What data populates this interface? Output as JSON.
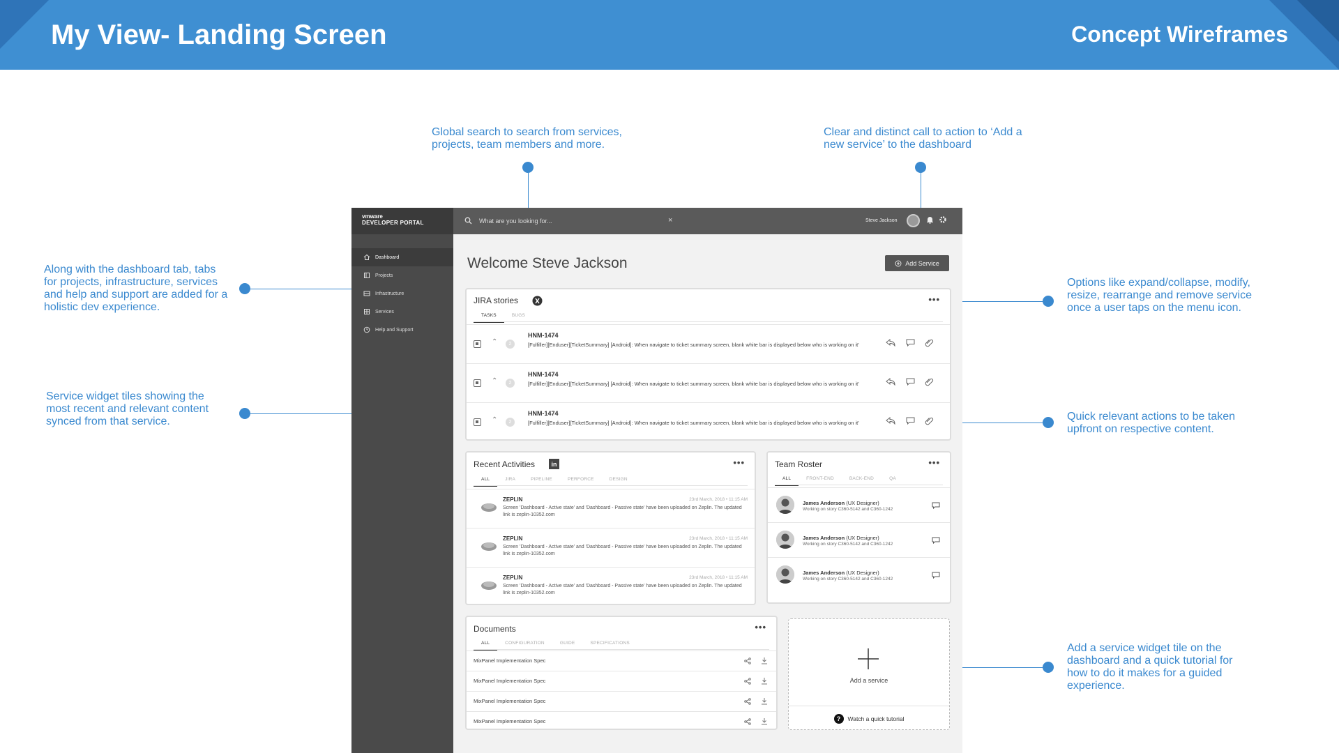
{
  "banner": {
    "title": "My View- Landing Screen",
    "subtitle": "Concept Wireframes"
  },
  "annotations": {
    "search": "Global search to search from services, projects, team members and more.",
    "add_service": "Clear and distinct call to action to ‘Add a new service’ to the dashboard",
    "tabs": "Along with the dashboard tab, tabs for projects, infrastructure, services and help and support are added for a holistic dev experience.",
    "widgets": "Service widget tiles showing the most recent and relevant content synced from that service.",
    "options": "Options like expand/collapse, modify, resize, rearrange and remove service once a user taps on the menu icon.",
    "quick_actions": "Quick relevant actions to be taken upfront on respective content.",
    "add_tile": "Add a service widget tile on the dashboard and a quick tutorial for how to do it makes for a guided experience."
  },
  "app": {
    "brand": {
      "logo": "vmware",
      "product": "DEVELOPER PORTAL"
    },
    "nav": [
      {
        "label": "Dashboard",
        "icon": "home-icon"
      },
      {
        "label": "Projects",
        "icon": "projects-icon"
      },
      {
        "label": "Infrastructure",
        "icon": "infrastructure-icon"
      },
      {
        "label": "Services",
        "icon": "services-icon"
      },
      {
        "label": "Help and Support",
        "icon": "help-icon"
      }
    ],
    "search": {
      "placeholder": "What are you looking for..."
    },
    "user": {
      "name": "Steve Jackson"
    },
    "welcome": "Welcome Steve Jackson",
    "add_service_label": "Add Service",
    "jira": {
      "title": "JIRA stories",
      "tabs": [
        "TASKS",
        "BUGS"
      ],
      "rows": [
        {
          "count": "2",
          "id": "HNM-1474",
          "desc": "[Fulfiller][Enduser][TicketSummary] [Android]: When navigate to ticket summary screen, blank white bar is displayed below who is working on it'"
        },
        {
          "count": "2",
          "id": "HNM-1474",
          "desc": "[Fulfiller][Enduser][TicketSummary] [Android]: When navigate to ticket summary screen, blank white bar is displayed below who is working on it'"
        },
        {
          "count": "2",
          "id": "HNM-1474",
          "desc": "[Fulfiller][Enduser][TicketSummary] [Android]: When navigate to ticket summary screen, blank white bar is displayed below who is working on it'"
        }
      ]
    },
    "activities": {
      "title": "Recent Activities",
      "badge": "in",
      "tabs": [
        "ALL",
        "JIRA",
        "PIPELINE",
        "PERFORCE",
        "DESIGN"
      ],
      "rows": [
        {
          "name": "ZEPLIN",
          "time": "23rd March, 2018 • 11:15 AM",
          "desc": "Screen 'Dashboard - Active state' and 'Dashboard - Passive state' have been uploaded on Zeplin. The updated link is zeplin-10352.com"
        },
        {
          "name": "ZEPLIN",
          "time": "23rd March, 2018 • 11:15 AM",
          "desc": "Screen 'Dashboard - Active state' and 'Dashboard - Passive state' have been uploaded on Zeplin. The updated link is zeplin-10352.com"
        },
        {
          "name": "ZEPLIN",
          "time": "23rd March, 2018 • 11:15 AM",
          "desc": "Screen 'Dashboard - Active state' and 'Dashboard - Passive state' have been uploaded on Zeplin. The updated link is zeplin-10352.com"
        }
      ]
    },
    "roster": {
      "title": "Team Roster",
      "tabs": [
        "ALL",
        "FRONT-END",
        "BACK-END",
        "QA"
      ],
      "rows": [
        {
          "name": "James Anderson",
          "role": "(UX Designer)",
          "sub": "Working on story C360-5142 and C360-1242"
        },
        {
          "name": "James Anderson",
          "role": "(UX Designer)",
          "sub": "Working on story C360-5142 and C360-1242"
        },
        {
          "name": "James Anderson",
          "role": "(UX Designer)",
          "sub": "Working on story C360-5142 and C360-1242"
        }
      ]
    },
    "documents": {
      "title": "Documents",
      "tabs": [
        "ALL",
        "CONFIGURATION",
        "GUIDE",
        "SPECIFICATIONS"
      ],
      "rows": [
        {
          "name": "MixPanel Implementation Spec"
        },
        {
          "name": "MixPanel Implementation Spec"
        },
        {
          "name": "MixPanel Implementation Spec"
        },
        {
          "name": "MixPanel Implementation Spec"
        }
      ]
    },
    "add_tile": {
      "label": "Add a service",
      "tutorial_badge": "?",
      "tutorial": "Watch a quick tutorial"
    }
  }
}
